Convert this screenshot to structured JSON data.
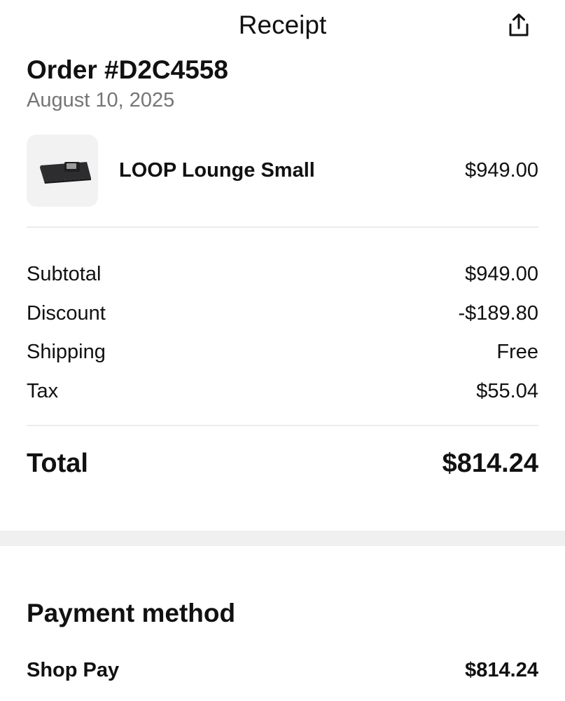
{
  "header": {
    "title": "Receipt",
    "share_icon": "share-icon"
  },
  "order": {
    "title": "Order #D2C4558",
    "date": "August 10, 2025"
  },
  "items": [
    {
      "name": "LOOP Lounge Small",
      "price": "$949.00",
      "thumbnail_icon": "product-thumbnail"
    }
  ],
  "summary": {
    "subtotal_label": "Subtotal",
    "subtotal_value": "$949.00",
    "discount_label": "Discount",
    "discount_value": "-$189.80",
    "shipping_label": "Shipping",
    "shipping_value": "Free",
    "tax_label": "Tax",
    "tax_value": "$55.04",
    "total_label": "Total",
    "total_value": "$814.24"
  },
  "payment": {
    "title": "Payment method",
    "method_label": "Shop Pay",
    "method_amount": "$814.24"
  },
  "colors": {
    "text": "#111111",
    "muted": "#757575",
    "divider": "#ececec",
    "section_band": "#f0f0f0",
    "thumb_bg": "#f2f2f2"
  }
}
